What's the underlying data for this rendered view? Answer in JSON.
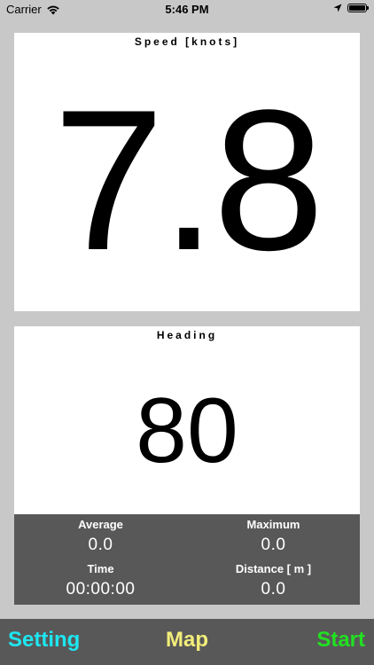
{
  "status_bar": {
    "carrier": "Carrier",
    "time": "5:46 PM",
    "icons": [
      "wifi-icon",
      "location-arrow-icon",
      "battery-icon"
    ]
  },
  "speed": {
    "label": "Speed [knots]",
    "value": "7.8"
  },
  "heading": {
    "label": "Heading",
    "value": "80"
  },
  "stats": {
    "average": {
      "label": "Average",
      "value": "0.0"
    },
    "maximum": {
      "label": "Maximum",
      "value": "0.0"
    },
    "time": {
      "label": "Time",
      "value": "00:00:00"
    },
    "distance": {
      "label": "Distance [ m ]",
      "value": "0.0"
    }
  },
  "toolbar": {
    "setting_label": "Setting",
    "map_label": "Map",
    "start_label": "Start"
  },
  "colors": {
    "background": "#c8c8c8",
    "panel": "#ffffff",
    "stats_bg": "#585858",
    "setting": "#1ee6f0",
    "map": "#f2ee7a",
    "start": "#22e022"
  }
}
